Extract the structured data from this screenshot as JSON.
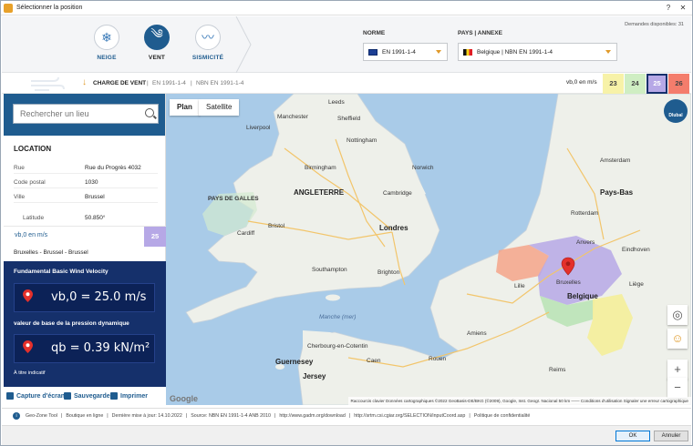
{
  "window": {
    "title": "Sélectionner la position"
  },
  "categories": [
    {
      "label": "NEIGE",
      "icon": "snowflake-icon",
      "glyph": "❄"
    },
    {
      "label": "VENT",
      "icon": "wind-icon",
      "glyph": "༄"
    },
    {
      "label": "SISMICITÉ",
      "icon": "seismic-icon",
      "glyph": "〰"
    }
  ],
  "norme": {
    "label": "NORME",
    "value": "EN 1991-1-4"
  },
  "pays": {
    "label": "PAYS | ANNEXE",
    "value": "Belgique | NBN EN 1991-1-4"
  },
  "demandes": "Demandes disponibles: 31",
  "subbar": {
    "title": "CHARGE DE VENT",
    "sep": "|",
    "norm1": "EN 1991-1-4",
    "norm2": "NBN EN 1991-1-4"
  },
  "zones": {
    "unit_label": "vb,0 en m/s",
    "values": [
      "23",
      "24",
      "25",
      "26"
    ],
    "colors": [
      "#f7f2a8",
      "#cfeec3",
      "#b6a8e6",
      "#f47d6c"
    ],
    "selected": "25"
  },
  "search": {
    "placeholder": "Rechercher un lieu"
  },
  "location": {
    "title": "LOCATION",
    "rows": [
      {
        "key": "Rue",
        "value": "Rue du Progrès 4032"
      },
      {
        "key": "Code postal",
        "value": "1030"
      },
      {
        "key": "Ville",
        "value": "Brussel"
      },
      {
        "key": "Latitude",
        "value": "50.850°"
      }
    ]
  },
  "vb0": {
    "label": "vb,0 en m/s",
    "value": "25"
  },
  "place": "Bruxelles - Brussel - Brussel",
  "results": {
    "heading1": "Fundamental Basic Wind Velocity",
    "value1": "vb,0 = 25.0 m/s",
    "heading2": "valeur de base de la pression dynamique",
    "value2": "qb = 0.39 kN/m²",
    "note": "À titre indicatif"
  },
  "actions": {
    "capture": "Capture d'écran",
    "save": "Sauvegarde",
    "print": "Imprimer"
  },
  "map": {
    "tabs": [
      "Plan",
      "Satellite"
    ],
    "labels": [
      {
        "text": "Leeds",
        "cls": ""
      },
      {
        "text": "Sheffield",
        "cls": ""
      },
      {
        "text": "Manchester",
        "cls": ""
      },
      {
        "text": "Liverpool",
        "cls": ""
      },
      {
        "text": "Nottingham",
        "cls": ""
      },
      {
        "text": "Birmingham",
        "cls": ""
      },
      {
        "text": "ANGLETERRE",
        "cls": "big"
      },
      {
        "text": "PAYS DE GALLES",
        "cls": ""
      },
      {
        "text": "Cardiff",
        "cls": ""
      },
      {
        "text": "Bristol",
        "cls": ""
      },
      {
        "text": "Londres",
        "cls": "big"
      },
      {
        "text": "Brighton",
        "cls": ""
      },
      {
        "text": "Southampton",
        "cls": ""
      },
      {
        "text": "Norwich",
        "cls": ""
      },
      {
        "text": "Cambridge",
        "cls": ""
      },
      {
        "text": "Manche (mer)",
        "cls": "sea"
      },
      {
        "text": "Cherbourg-en-Cotentin",
        "cls": ""
      },
      {
        "text": "Guernesey",
        "cls": "big"
      },
      {
        "text": "Jersey",
        "cls": "big"
      },
      {
        "text": "Caen",
        "cls": ""
      },
      {
        "text": "Rouen",
        "cls": ""
      },
      {
        "text": "Amiens",
        "cls": ""
      },
      {
        "text": "Lille",
        "cls": ""
      },
      {
        "text": "Belgique",
        "cls": "big"
      },
      {
        "text": "Pays-Bas",
        "cls": "big"
      },
      {
        "text": "Amsterdam",
        "cls": ""
      },
      {
        "text": "Rotterdam",
        "cls": ""
      },
      {
        "text": "Anvers",
        "cls": ""
      },
      {
        "text": "Bruxelles",
        "cls": ""
      },
      {
        "text": "Liège",
        "cls": ""
      },
      {
        "text": "Eindhoven",
        "cls": ""
      },
      {
        "text": "Reims",
        "cls": ""
      }
    ],
    "attribution": "Raccourcis clavier   Données cartographiques ©2022 GeoBasis-DE/BKG (©2009), Google, Inst. Geogr. Nacional   50 km ——   Conditions d'utilisation   Signaler une erreur cartographique",
    "google": "Google",
    "dlubal": "Dlubal"
  },
  "footer": {
    "items": [
      "Geo-Zone Tool",
      "|",
      "Boutique en ligne",
      "|",
      "Dernière mise à jour: 14.10.2022",
      "|",
      "Source: NBN EN 1991-1-4 ANB 2010",
      "|",
      "http://www.gadm.org/download",
      "|",
      "http://srtm.csi.cgiar.org/SELECTION/inputCoord.asp",
      "|",
      "Politique de confidentialité"
    ]
  },
  "buttons": {
    "ok": "OK",
    "cancel": "Annuler"
  }
}
